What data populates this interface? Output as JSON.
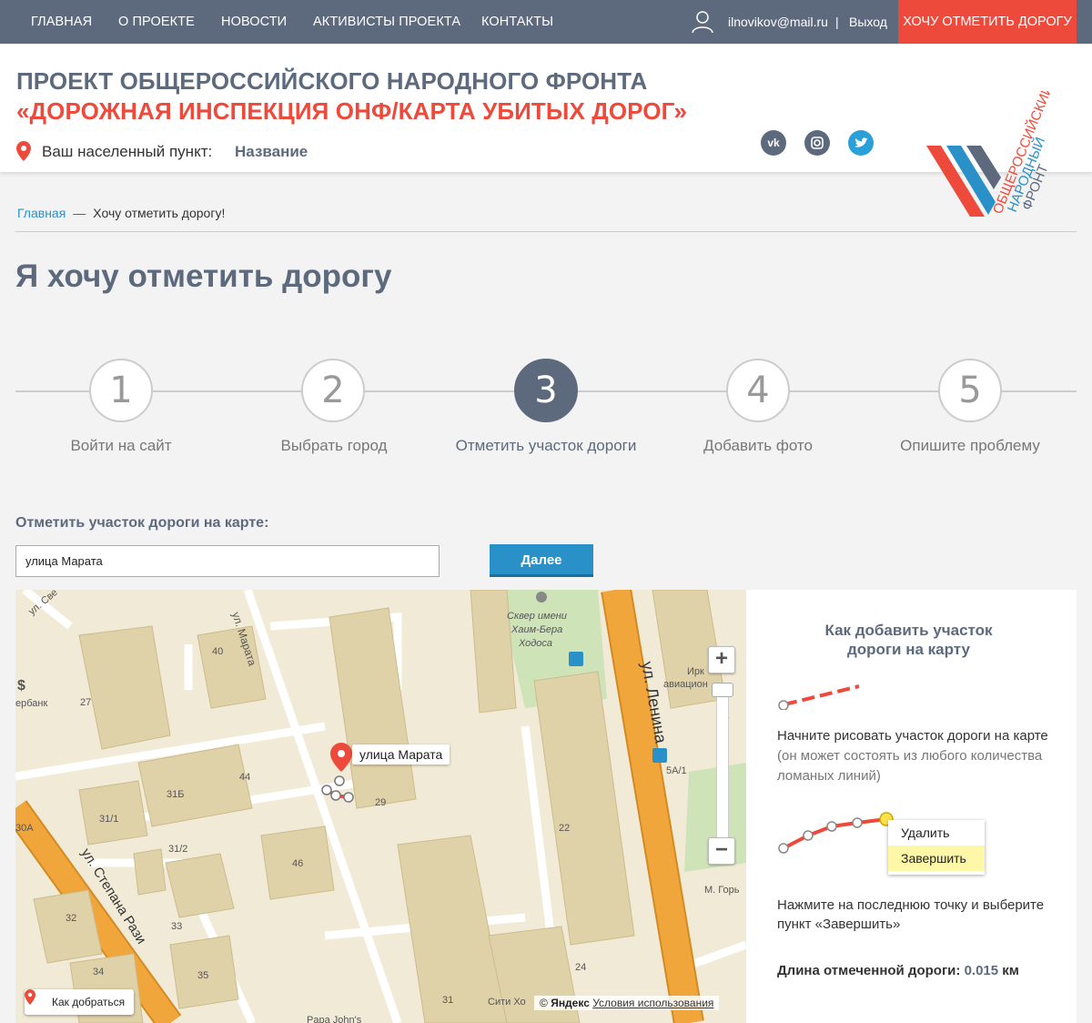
{
  "nav": {
    "items": [
      "ГЛАВНАЯ",
      "О ПРОЕКТЕ",
      "НОВОСТИ",
      "АКТИВИСТЫ ПРОЕКТА",
      "КОНТАКТЫ"
    ],
    "email": "ilnovikov@mail.ru",
    "separator": "|",
    "logout": "Выход",
    "cta": "ХОЧУ ОТМЕТИТЬ ДОРОГУ"
  },
  "header": {
    "title_line1": "ПРОЕКТ ОБЩЕРОССИЙСКОГО НАРОДНОГО ФРОНТА",
    "title_line2": "«ДОРОЖНАЯ ИНСПЕКЦИЯ ОНФ/КАРТА УБИТЫХ ДОРОГ»",
    "location_label": "Ваш населенный пункт:",
    "location_value": "Название",
    "social": [
      "vk-icon",
      "instagram-icon",
      "twitter-icon"
    ],
    "logo_lines": [
      "ОБЩЕРОССИЙСКИЙ",
      "НАРОДНЫЙ",
      "ФРОНТ"
    ]
  },
  "breadcrumb": {
    "home": "Главная",
    "dash": "—",
    "current": "Хочу отметить дорогу!"
  },
  "page_title": "Я хочу отметить дорогу",
  "steps": [
    {
      "num": "1",
      "label": "Войти на сайт",
      "active": false
    },
    {
      "num": "2",
      "label": "Выбрать город",
      "active": false
    },
    {
      "num": "3",
      "label": "Отметить участок дороги",
      "active": true
    },
    {
      "num": "4",
      "label": "Добавить фото",
      "active": false
    },
    {
      "num": "5",
      "label": "Опишите проблему",
      "active": false
    }
  ],
  "form": {
    "label": "Отметить участок дороги на карте:",
    "search_value": "улица Марата",
    "next_button": "Далее"
  },
  "map": {
    "marker_label": "улица Марата",
    "route_button": "Как добраться",
    "copyright_symbol": "©",
    "copyright_brand": "Яндекс",
    "terms": "Условия использования",
    "zoom_in": "+",
    "zoom_out": "−",
    "labels": [
      "ул. Марата",
      "ул. Ленина",
      "ул. Степана Рази",
      "ул. Све",
      "Сквер имени",
      "Хаим-Бера",
      "Ходоса",
      "Ирк",
      "авиацион",
      "М. Горь",
      "Сити Хо",
      "Papa John's",
      "ербанк",
      "30А",
      "40",
      "27",
      "44",
      "31Б",
      "31/1",
      "31/2",
      "46",
      "29",
      "22",
      "5А",
      "5А/1",
      "32",
      "33",
      "34",
      "35",
      "24",
      "31"
    ],
    "colors": {
      "main_road": "#f0a63a",
      "buildings": "#e0d2a8",
      "background": "#f1ead6",
      "park": "#cfe3b9"
    }
  },
  "panel": {
    "title": "Как добавить участок дороги на карту",
    "step1_main": "Начните рисовать участок дороги на карте",
    "step1_muted": "(он может состоять из любого количества ломаных линий)",
    "menu_delete": "Удалить",
    "menu_finish": "Завершить",
    "step2": "Нажмите на последнюю точку и выберите пункт «Завершить»",
    "length_label": "Длина отмеченной дороги:",
    "length_value": "0.015",
    "length_unit": "км"
  },
  "colors": {
    "nav_bg": "#5d6a7e",
    "accent_red": "#ee4a3b",
    "accent_blue": "#2a90c8",
    "title_gray": "#5d6a7e"
  }
}
